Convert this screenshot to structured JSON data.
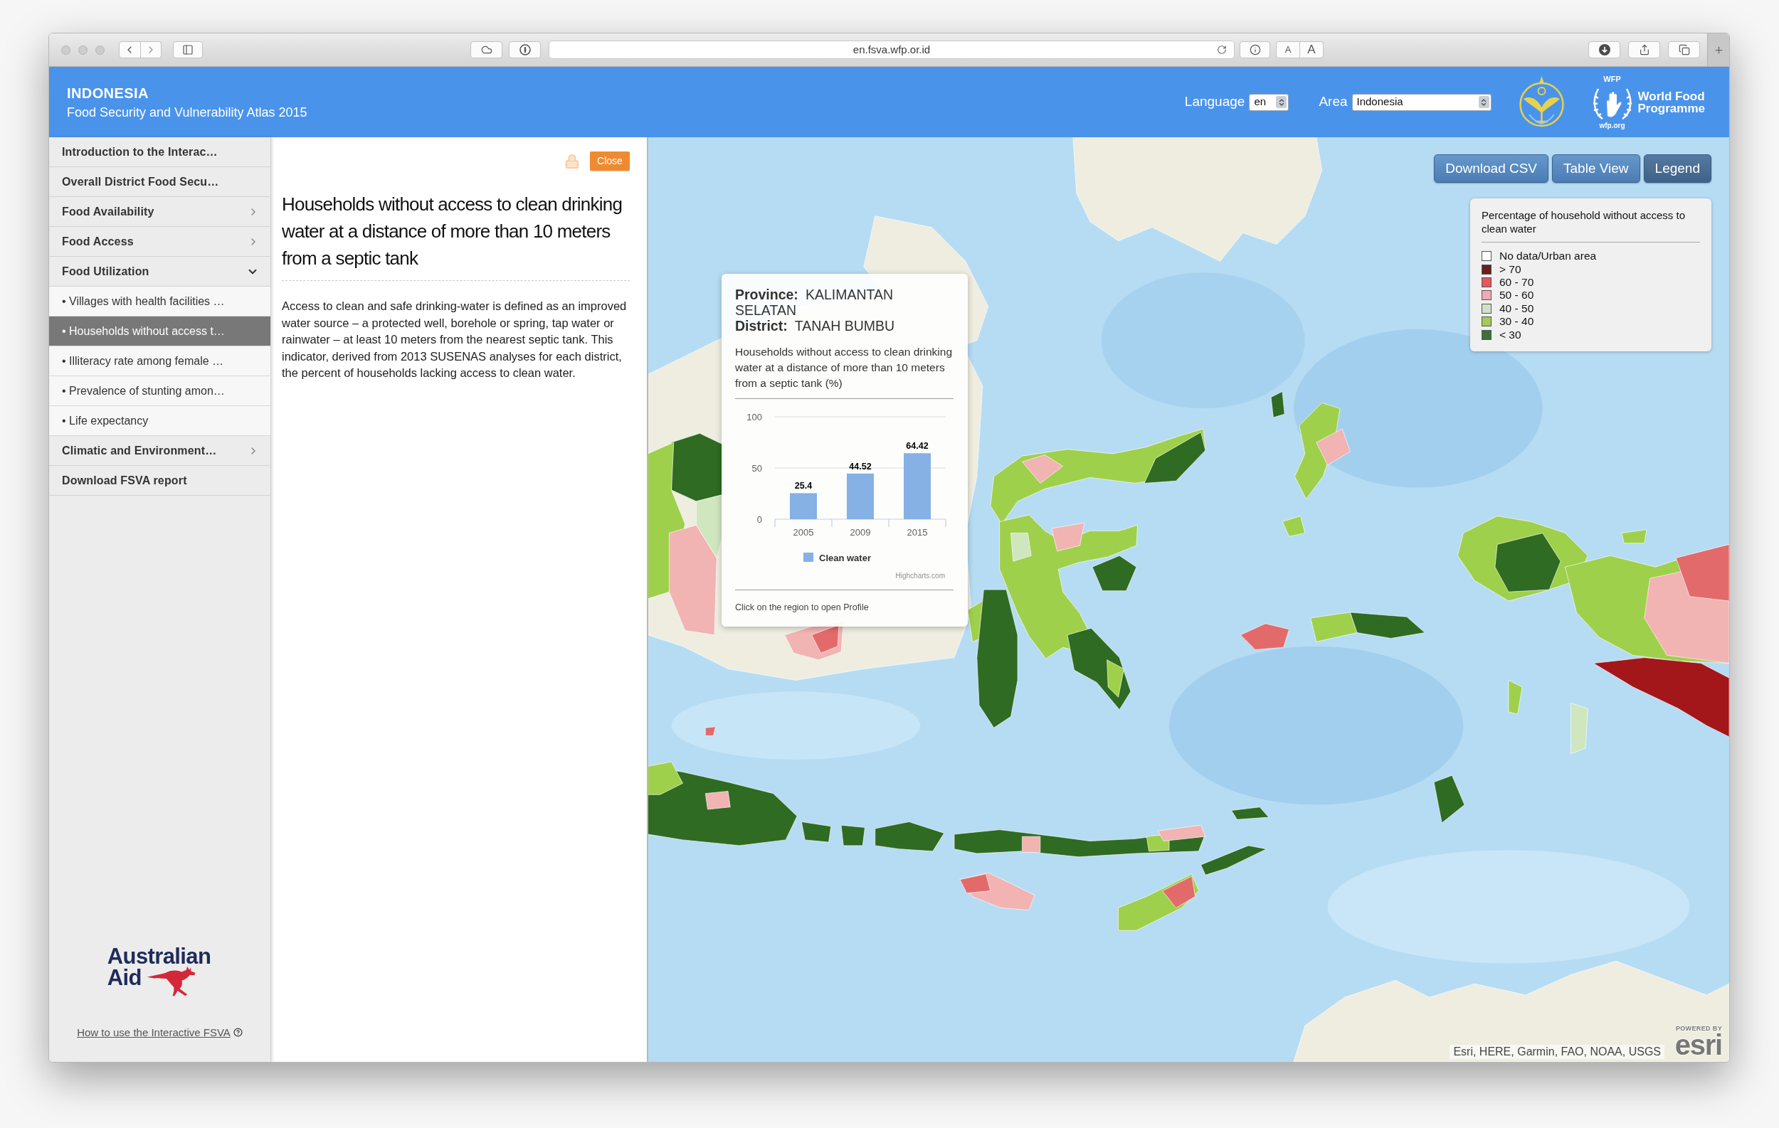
{
  "browser": {
    "url": "en.fsva.wfp.or.id",
    "text_size_buttons": [
      "A",
      "A"
    ]
  },
  "header": {
    "title": "INDONESIA",
    "subtitle": "Food Security and Vulnerability Atlas 2015",
    "language": {
      "label": "Language",
      "value": "en"
    },
    "area": {
      "label": "Area",
      "value": "Indonesia"
    },
    "logo": {
      "caption": "WFP",
      "name_lines": [
        "World Food",
        "Programme"
      ],
      "url": "wfp.org"
    }
  },
  "sidebar": {
    "items": [
      {
        "kind": "link",
        "label": "Introduction to the Interac…",
        "selected": false
      },
      {
        "kind": "link",
        "label": "Overall District Food Secu…",
        "selected": false
      },
      {
        "kind": "group",
        "label": "Food Availability",
        "selected": false,
        "expanded": false
      },
      {
        "kind": "group",
        "label": "Food Access",
        "selected": false,
        "expanded": false
      },
      {
        "kind": "group",
        "label": "Food Utilization",
        "selected": false,
        "expanded": true,
        "children": [
          {
            "label": "• Villages with health facilities …",
            "selected": false
          },
          {
            "label": "• Households without access t…",
            "selected": true
          },
          {
            "label": "• Illiteracy rate among female …",
            "selected": false
          },
          {
            "label": "• Prevalence of stunting amon…",
            "selected": false
          },
          {
            "label": "• Life expectancy",
            "selected": false
          }
        ]
      },
      {
        "kind": "group",
        "label": "Climatic and Environment…",
        "selected": false,
        "expanded": false
      },
      {
        "kind": "link",
        "label": "Download FSVA report",
        "selected": false
      }
    ],
    "sponsor": {
      "lines": [
        "Australian",
        "Aid"
      ]
    },
    "help_link": "How to use the Interactive FSVA"
  },
  "info_panel": {
    "close_button": "Close",
    "title": "Households without access to clean drinking water at a distance of more than 10 meters from a septic tank",
    "description": "Access to clean and safe drinking-water is defined as an improved water source – a protected well, borehole or spring, tap water or rainwater – at least 10 meters from the nearest septic tank. This indicator, derived from 2013 SUSENAS analyses for each district, the percent of households lacking access to clean water."
  },
  "map": {
    "buttons": [
      {
        "label": "Download CSV",
        "selected": false
      },
      {
        "label": "Table View",
        "selected": false
      },
      {
        "label": "Legend",
        "selected": true
      }
    ],
    "legend": {
      "title": "Percentage of household without access to clean water",
      "items": [
        {
          "label": "No data/Urban area",
          "color": "#ffffff"
        },
        {
          "label": "> 70",
          "color": "#6a1e1e"
        },
        {
          "label": "60 - 70",
          "color": "#e05a5e"
        },
        {
          "label": "50 - 60",
          "color": "#eeaab0"
        },
        {
          "label": "40 - 50",
          "color": "#cfe2c8"
        },
        {
          "label": "30 - 40",
          "color": "#a3cb58"
        },
        {
          "label": "< 30",
          "color": "#3f6e3a"
        }
      ]
    },
    "popup": {
      "province": {
        "label": "Province:",
        "value": "KALIMANTAN SELATAN"
      },
      "district": {
        "label": "District:",
        "value": "TANAH BUMBU"
      },
      "indicator": "Households without access to clean drinking water at a distance of more than 10 meters from a septic tank (%)",
      "chart_data": {
        "type": "bar",
        "categories": [
          "2005",
          "2009",
          "2015"
        ],
        "series": [
          {
            "name": "Clean water",
            "color": "#85b1e4",
            "values": [
              25.4,
              44.52,
              64.42
            ]
          }
        ],
        "ylim": [
          0,
          100
        ],
        "yticks": [
          0,
          50,
          100
        ],
        "data_labels": true
      },
      "chart_credit": "Highcharts.com",
      "footer": "Click on the region to open Profile"
    },
    "attribution": "Esri, HERE, Garmin, FAO, NOAA, USGS",
    "esri_logo": {
      "caption": "POWERED BY",
      "wordmark": "esri"
    }
  }
}
